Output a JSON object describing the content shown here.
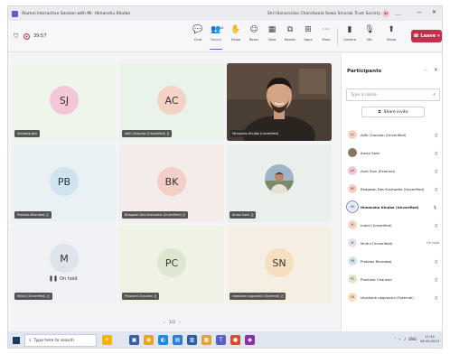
{
  "window": {
    "title": "Alumni Interactive Session with Mr. Himanshu Khulbe",
    "org": "Shri Banarsidas Chandiwala Sewa Smarak Trust Society",
    "org_avatar": "SI",
    "more": "...",
    "minimize": "—",
    "close": "✕"
  },
  "meeting": {
    "timer": "39:57",
    "toolbar": [
      {
        "label": "Chat",
        "icon": "💬"
      },
      {
        "label": "People",
        "icon": "👥",
        "badge": "14"
      },
      {
        "label": "Raise",
        "icon": "✋"
      },
      {
        "label": "React",
        "icon": "☺"
      },
      {
        "label": "View",
        "icon": "▦"
      },
      {
        "label": "Rooms",
        "icon": "⧉"
      },
      {
        "label": "Apps",
        "icon": "⊞"
      },
      {
        "label": "More",
        "icon": "⋯"
      },
      {
        "label": "Camera",
        "icon": "▮"
      },
      {
        "label": "Mic",
        "icon": "🎙"
      },
      {
        "label": "Share",
        "icon": "⬆"
      }
    ],
    "leave_label": "Leave"
  },
  "tiles": [
    {
      "initials": "SJ",
      "name": "Sandeep Jain",
      "bg": "#eef5ea",
      "av_bg": "#f3c7d7",
      "mic": ""
    },
    {
      "initials": "AC",
      "name": "Aditi Chauhan (Unverified)",
      "bg": "#eaf3ea",
      "av_bg": "#f5d2c6",
      "mic": "🎙̸"
    },
    {
      "initials": "",
      "name": "Himanshu Khulbe (Unverified)",
      "bg": "#3a3027",
      "av_bg": "",
      "mic": ""
    },
    {
      "initials": "PB",
      "name": "Prabhas Bhardwaj",
      "bg": "#eaf1f4",
      "av_bg": "#cfe4ef",
      "mic": "🎙̸"
    },
    {
      "initials": "BK",
      "name": "Bhagwan Das Kushwaha (Unverified)",
      "bg": "#f3ecea",
      "av_bg": "#f2cfc7",
      "mic": "🎙̸"
    },
    {
      "initials": "",
      "name": "Aman Saini",
      "bg": "#e9f0ec",
      "av_bg": "",
      "mic": "🎙̸"
    },
    {
      "initials": "M",
      "name": "Mridul (Unverified)",
      "bg": "#f0f1f4",
      "av_bg": "#dfe4ec",
      "mic": "🎙̸"
    },
    {
      "initials": "PC",
      "name": "Prashant Chauhan",
      "bg": "#eef3e6",
      "av_bg": "#dbe8cf",
      "mic": "🎙̸"
    },
    {
      "initials": "SN",
      "name": "shashank nagvanshi (External)",
      "bg": "#f5efe3",
      "av_bg": "#f6dfbf",
      "mic": "🎙̸"
    }
  ],
  "on_hold_label": "On hold",
  "pager": {
    "prev": "‹",
    "label": "1/2",
    "next": "›"
  },
  "participants": {
    "title": "Participants",
    "more": "⋯",
    "close": "✕",
    "search_placeholder": "Type a name",
    "share_invite": "Share invite",
    "items": [
      {
        "initials": "AC",
        "name": "Aditi Chauhan (Unverified)",
        "av_bg": "#f5d2c6",
        "av_fg": "#8a3b25",
        "status": ""
      },
      {
        "initials": "",
        "name": "Aman Saini",
        "av_bg": "#8a7560",
        "av_fg": "#fff",
        "status": ""
      },
      {
        "initials": "AS",
        "name": "Amit Sain (External)",
        "av_bg": "#f3c7d7",
        "av_fg": "#8d2d55",
        "status": ""
      },
      {
        "initials": "BK",
        "name": "Bhagwan Das Kushwaha (Unverified)",
        "av_bg": "#f2cfc7",
        "av_fg": "#8a3b25",
        "status": ""
      },
      {
        "initials": "HK",
        "name": "Himanshu Khulbe (Unverified)",
        "av_bg": "#dfe9f5",
        "av_fg": "#2b5a8a",
        "status": ""
      },
      {
        "initials": "M",
        "name": "mohit (Unverified)",
        "av_bg": "#f5d2c6",
        "av_fg": "#8a3b25",
        "status": ""
      },
      {
        "initials": "M",
        "name": "Mridul (Unverified)",
        "av_bg": "#dfe4ec",
        "av_fg": "#3b4a60",
        "status": "On hold"
      },
      {
        "initials": "PB",
        "name": "Prabhas Bhardwaj",
        "av_bg": "#cfe4ef",
        "av_fg": "#2b5a6a",
        "status": ""
      },
      {
        "initials": "PC",
        "name": "Prashant Chauhan",
        "av_bg": "#dbe8cf",
        "av_fg": "#3d5a2a",
        "status": ""
      },
      {
        "initials": "SN",
        "name": "shashank nagvanshi (External)",
        "av_bg": "#f6dfbf",
        "av_fg": "#7a5220",
        "status": ""
      }
    ]
  },
  "taskbar": {
    "search_placeholder": "Type here to search",
    "tray": "ENG",
    "time": "11:34",
    "date": "06-09-2023"
  }
}
